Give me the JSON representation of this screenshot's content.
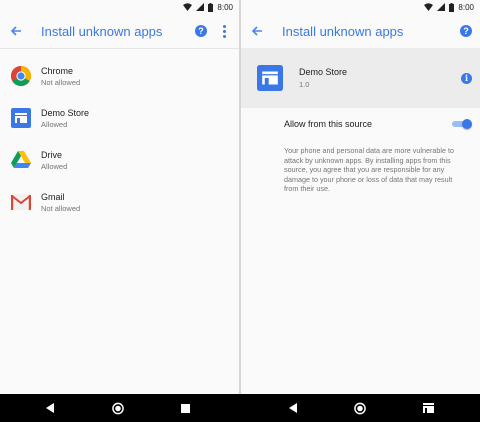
{
  "status_bar": {
    "time": "8:00"
  },
  "left": {
    "title": "Install unknown apps",
    "apps": [
      {
        "name": "Chrome",
        "status": "Not allowed",
        "icon": "chrome-icon"
      },
      {
        "name": "Demo Store",
        "status": "Allowed",
        "icon": "store-icon"
      },
      {
        "name": "Drive",
        "status": "Allowed",
        "icon": "drive-icon"
      },
      {
        "name": "Gmail",
        "status": "Not allowed",
        "icon": "gmail-icon"
      }
    ]
  },
  "right": {
    "title": "Install unknown apps",
    "app": {
      "name": "Demo Store",
      "version": "1.0",
      "icon": "store-icon"
    },
    "toggle": {
      "label": "Allow from this source",
      "on": true
    },
    "warning": "Your phone and personal data are more vulnerable to attack by unknown apps. By installing apps from this source, you agree that you are responsible for any damage to your phone or loss of data that may result from their use."
  },
  "colors": {
    "accent": "#3b78e7",
    "header_bg": "#ececec"
  }
}
